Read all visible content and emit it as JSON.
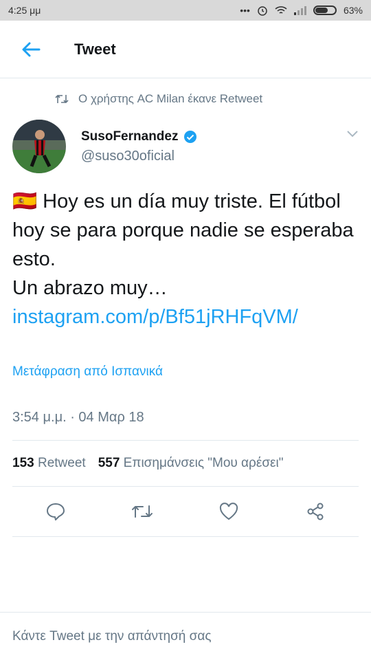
{
  "status_bar": {
    "time": "4:25 μμ",
    "battery": "63%",
    "battery_level": 0.63
  },
  "header": {
    "title": "Tweet"
  },
  "retweet_context": {
    "text": "Ο χρήστης AC Milan έκανε Retweet"
  },
  "author": {
    "name": "SusoFernandez",
    "handle": "@suso30oficial"
  },
  "tweet": {
    "line1_flag": "🇪🇸",
    "text_part": "Hoy es un día muy triste. El fútbol hoy se para porque nadie se esperaba esto.",
    "text_part2": "Un abrazo muy…",
    "link": "instagram.com/p/Bf51jRHFqVM/"
  },
  "translate_label": "Μετάφραση από Ισπανικά",
  "timestamp": "3:54 μ.μ. · 04 Μαρ 18",
  "stats": {
    "retweets": "153",
    "retweets_label": "Retweet",
    "likes": "557",
    "likes_label": "Επισημάνσεις \"Μου αρέσει\""
  },
  "reply": {
    "placeholder": "Κάντε Tweet με την απάντησή σας"
  },
  "colors": {
    "accent": "#1da1f2",
    "muted": "#657786",
    "verified": "#1da1f2"
  },
  "icons": [
    "arrow-left-icon",
    "retweet-icon",
    "verified-icon",
    "chevron-down-icon",
    "reply-icon",
    "retweet-icon",
    "heart-icon",
    "share-icon"
  ]
}
